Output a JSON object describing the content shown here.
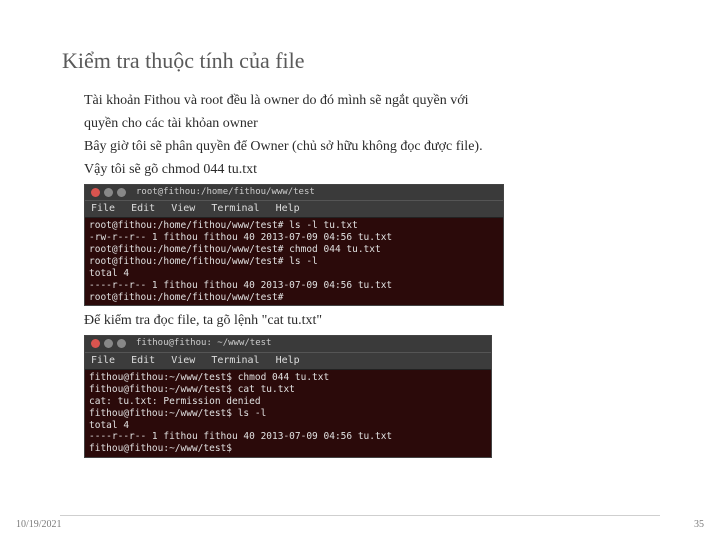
{
  "title": "Kiểm tra thuộc tính của file",
  "para1_l1": "Tài khoản Fithou và root đều là owner do đó mình sẽ ngắt quyền với",
  "para1_l2": "quyền cho các tài khỏan owner",
  "para1_l3": "Bây giờ tôi sẽ phân quyền để Owner (chủ sở hữu không đọc được file).",
  "para1_l4": "Vậy tôi sẽ gõ chmod 044 tu.txt",
  "term1": {
    "win_title": "root@fithou:/home/fithou/www/test",
    "menu_file": "File",
    "menu_edit": "Edit",
    "menu_view": "View",
    "menu_terminal": "Terminal",
    "menu_help": "Help",
    "content": "root@fithou:/home/fithou/www/test# ls -l tu.txt\n-rw-r--r-- 1 fithou fithou 40 2013-07-09 04:56 tu.txt\nroot@fithou:/home/fithou/www/test# chmod 044 tu.txt\nroot@fithou:/home/fithou/www/test# ls -l\ntotal 4\n----r--r-- 1 fithou fithou 40 2013-07-09 04:56 tu.txt\nroot@fithou:/home/fithou/www/test# "
  },
  "para2": "Để kiểm tra đọc file, ta gõ lệnh \"cat tu.txt\"",
  "term2": {
    "win_title": "fithou@fithou: ~/www/test",
    "menu_file": "File",
    "menu_edit": "Edit",
    "menu_view": "View",
    "menu_terminal": "Terminal",
    "menu_help": "Help",
    "content": "fithou@fithou:~/www/test$ chmod 044 tu.txt\nfithou@fithou:~/www/test$ cat tu.txt\ncat: tu.txt: Permission denied\nfithou@fithou:~/www/test$ ls -l\ntotal 4\n----r--r-- 1 fithou fithou 40 2013-07-09 04:56 tu.txt\nfithou@fithou:~/www/test$ "
  },
  "footer": {
    "date": "10/19/2021",
    "page": "35"
  }
}
